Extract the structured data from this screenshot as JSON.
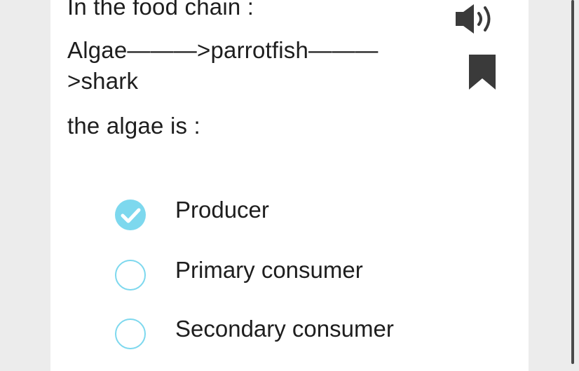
{
  "question": {
    "line1": "In the food chain :",
    "line2": "Algae———>parrotfish———>shark",
    "line3": "the algae is :"
  },
  "icons": {
    "audio": "speaker-icon",
    "bookmark": "bookmark-icon",
    "selected": "check-circle-icon",
    "unselected": "empty-circle-icon"
  },
  "colors": {
    "accent": "#7dd8ee",
    "text": "#1e1e1e",
    "icon": "#3a3a3a"
  },
  "options": [
    {
      "label": "Producer",
      "selected": true
    },
    {
      "label": "Primary consumer",
      "selected": false
    },
    {
      "label": "Secondary consumer",
      "selected": false
    }
  ]
}
